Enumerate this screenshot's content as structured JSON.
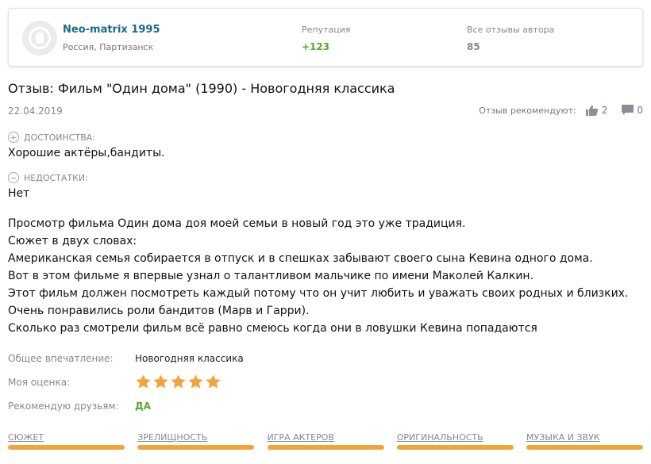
{
  "author": {
    "name": "Neo-matrix 1995",
    "location": "Россия, Партизанск",
    "reputation_label": "Репутация",
    "reputation_value": "+123",
    "all_reviews_label": "Все отзывы автора",
    "all_reviews_value": "85"
  },
  "review": {
    "title": "Отзыв: Фильм \"Один дома\" (1990) - Новогодняя классика",
    "date": "22.04.2019",
    "recommend_label": "Отзыв рекомендуют:",
    "likes": "2",
    "comments": "0",
    "pros_label": "ДОСТОИНСТВА:",
    "pros_text": "Хорошие актёры,бандиты.",
    "cons_label": "НЕДОСТАТКИ:",
    "cons_text": "Нет",
    "body": [
      "Просмотр фильма Один дома доя моей семьи в новый год это уже традиция.",
      "Сюжет в двух словах:",
      "Американская семья собирается в отпуск и в спешках забывают своего сына Кевина одного дома.",
      "Вот в этом фильме я впервые узнал о талантливом мальчике по имени Маколей Калкин.",
      "Этот фильм должен посмотреть каждый потому что он учит любить и уважать своих родных и близких. Очень понравились роли бандитов (Марв и Гарри).",
      "Сколько раз смотрели фильм всё равно смеюсь когда они в ловушки Кевина попадаются"
    ],
    "impression_label": "Общее впечатление:",
    "impression_value": "Новогодняя классика",
    "rating_label": "Моя оценка:",
    "rating_stars": 5,
    "recommend_friends_label": "Рекомендую друзьям:",
    "recommend_friends_value": "ДА"
  },
  "ratings": [
    {
      "label": "СЮЖЕТ",
      "fill": 1.0
    },
    {
      "label": "ЗРЕЛИЩНОСТЬ",
      "fill": 1.0
    },
    {
      "label": "ИГРА АКТЕРОВ",
      "fill": 1.0
    },
    {
      "label": "ОРИГИНАЛЬНОСТЬ",
      "fill": 1.0
    },
    {
      "label": "МУЗЫКА И ЗВУК",
      "fill": 1.0
    }
  ],
  "colors": {
    "accent_link": "#1b6b8c",
    "positive": "#5aa532",
    "star": "#f2a43a"
  },
  "icons": [
    "avatar-icon",
    "thumbs-up-icon",
    "comment-icon",
    "plus-circle-icon",
    "minus-circle-icon",
    "star-icon"
  ]
}
